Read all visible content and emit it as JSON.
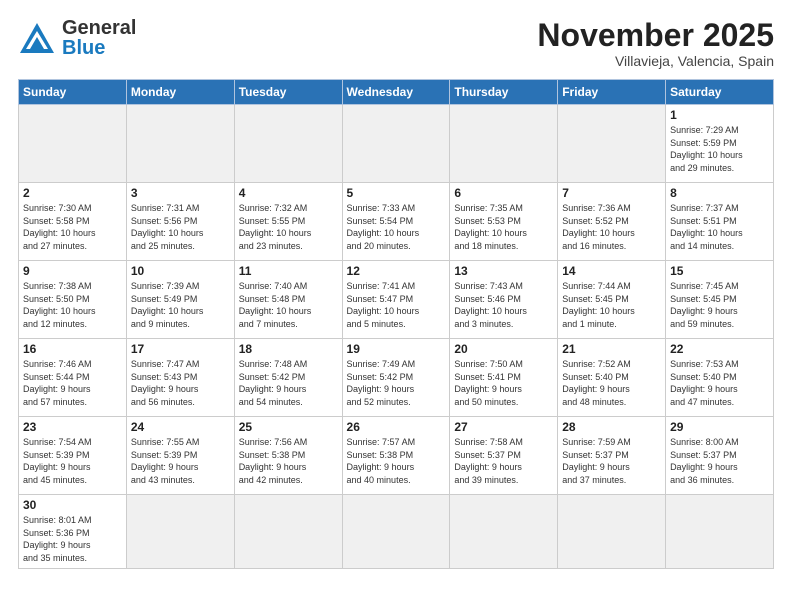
{
  "header": {
    "logo_general": "General",
    "logo_blue": "Blue",
    "month_title": "November 2025",
    "location": "Villavieja, Valencia, Spain"
  },
  "days_of_week": [
    "Sunday",
    "Monday",
    "Tuesday",
    "Wednesday",
    "Thursday",
    "Friday",
    "Saturday"
  ],
  "weeks": [
    [
      {
        "day": "",
        "info": "",
        "empty": true
      },
      {
        "day": "",
        "info": "",
        "empty": true
      },
      {
        "day": "",
        "info": "",
        "empty": true
      },
      {
        "day": "",
        "info": "",
        "empty": true
      },
      {
        "day": "",
        "info": "",
        "empty": true
      },
      {
        "day": "",
        "info": "",
        "empty": true
      },
      {
        "day": "1",
        "info": "Sunrise: 7:29 AM\nSunset: 5:59 PM\nDaylight: 10 hours\nand 29 minutes."
      }
    ],
    [
      {
        "day": "2",
        "info": "Sunrise: 7:30 AM\nSunset: 5:58 PM\nDaylight: 10 hours\nand 27 minutes."
      },
      {
        "day": "3",
        "info": "Sunrise: 7:31 AM\nSunset: 5:56 PM\nDaylight: 10 hours\nand 25 minutes."
      },
      {
        "day": "4",
        "info": "Sunrise: 7:32 AM\nSunset: 5:55 PM\nDaylight: 10 hours\nand 23 minutes."
      },
      {
        "day": "5",
        "info": "Sunrise: 7:33 AM\nSunset: 5:54 PM\nDaylight: 10 hours\nand 20 minutes."
      },
      {
        "day": "6",
        "info": "Sunrise: 7:35 AM\nSunset: 5:53 PM\nDaylight: 10 hours\nand 18 minutes."
      },
      {
        "day": "7",
        "info": "Sunrise: 7:36 AM\nSunset: 5:52 PM\nDaylight: 10 hours\nand 16 minutes."
      },
      {
        "day": "8",
        "info": "Sunrise: 7:37 AM\nSunset: 5:51 PM\nDaylight: 10 hours\nand 14 minutes."
      }
    ],
    [
      {
        "day": "9",
        "info": "Sunrise: 7:38 AM\nSunset: 5:50 PM\nDaylight: 10 hours\nand 12 minutes."
      },
      {
        "day": "10",
        "info": "Sunrise: 7:39 AM\nSunset: 5:49 PM\nDaylight: 10 hours\nand 9 minutes."
      },
      {
        "day": "11",
        "info": "Sunrise: 7:40 AM\nSunset: 5:48 PM\nDaylight: 10 hours\nand 7 minutes."
      },
      {
        "day": "12",
        "info": "Sunrise: 7:41 AM\nSunset: 5:47 PM\nDaylight: 10 hours\nand 5 minutes."
      },
      {
        "day": "13",
        "info": "Sunrise: 7:43 AM\nSunset: 5:46 PM\nDaylight: 10 hours\nand 3 minutes."
      },
      {
        "day": "14",
        "info": "Sunrise: 7:44 AM\nSunset: 5:45 PM\nDaylight: 10 hours\nand 1 minute."
      },
      {
        "day": "15",
        "info": "Sunrise: 7:45 AM\nSunset: 5:45 PM\nDaylight: 9 hours\nand 59 minutes."
      }
    ],
    [
      {
        "day": "16",
        "info": "Sunrise: 7:46 AM\nSunset: 5:44 PM\nDaylight: 9 hours\nand 57 minutes."
      },
      {
        "day": "17",
        "info": "Sunrise: 7:47 AM\nSunset: 5:43 PM\nDaylight: 9 hours\nand 56 minutes."
      },
      {
        "day": "18",
        "info": "Sunrise: 7:48 AM\nSunset: 5:42 PM\nDaylight: 9 hours\nand 54 minutes."
      },
      {
        "day": "19",
        "info": "Sunrise: 7:49 AM\nSunset: 5:42 PM\nDaylight: 9 hours\nand 52 minutes."
      },
      {
        "day": "20",
        "info": "Sunrise: 7:50 AM\nSunset: 5:41 PM\nDaylight: 9 hours\nand 50 minutes."
      },
      {
        "day": "21",
        "info": "Sunrise: 7:52 AM\nSunset: 5:40 PM\nDaylight: 9 hours\nand 48 minutes."
      },
      {
        "day": "22",
        "info": "Sunrise: 7:53 AM\nSunset: 5:40 PM\nDaylight: 9 hours\nand 47 minutes."
      }
    ],
    [
      {
        "day": "23",
        "info": "Sunrise: 7:54 AM\nSunset: 5:39 PM\nDaylight: 9 hours\nand 45 minutes."
      },
      {
        "day": "24",
        "info": "Sunrise: 7:55 AM\nSunset: 5:39 PM\nDaylight: 9 hours\nand 43 minutes."
      },
      {
        "day": "25",
        "info": "Sunrise: 7:56 AM\nSunset: 5:38 PM\nDaylight: 9 hours\nand 42 minutes."
      },
      {
        "day": "26",
        "info": "Sunrise: 7:57 AM\nSunset: 5:38 PM\nDaylight: 9 hours\nand 40 minutes."
      },
      {
        "day": "27",
        "info": "Sunrise: 7:58 AM\nSunset: 5:37 PM\nDaylight: 9 hours\nand 39 minutes."
      },
      {
        "day": "28",
        "info": "Sunrise: 7:59 AM\nSunset: 5:37 PM\nDaylight: 9 hours\nand 37 minutes."
      },
      {
        "day": "29",
        "info": "Sunrise: 8:00 AM\nSunset: 5:37 PM\nDaylight: 9 hours\nand 36 minutes."
      }
    ],
    [
      {
        "day": "30",
        "info": "Sunrise: 8:01 AM\nSunset: 5:36 PM\nDaylight: 9 hours\nand 35 minutes.",
        "last": true
      },
      {
        "day": "",
        "info": "",
        "empty": true,
        "last": true
      },
      {
        "day": "",
        "info": "",
        "empty": true,
        "last": true
      },
      {
        "day": "",
        "info": "",
        "empty": true,
        "last": true
      },
      {
        "day": "",
        "info": "",
        "empty": true,
        "last": true
      },
      {
        "day": "",
        "info": "",
        "empty": true,
        "last": true
      },
      {
        "day": "",
        "info": "",
        "empty": true,
        "last": true
      }
    ]
  ]
}
